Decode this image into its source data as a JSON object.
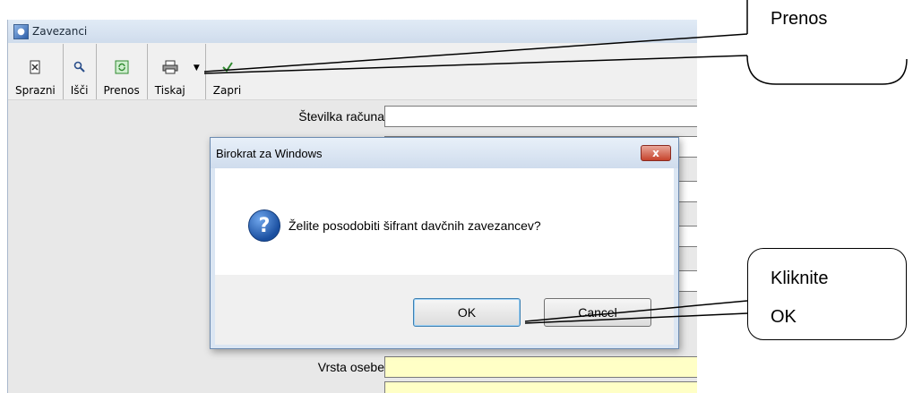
{
  "window": {
    "title": "Zavezanci",
    "icon": "app-icon"
  },
  "toolbar": {
    "buttons": [
      {
        "label": "Sprazni",
        "icon": "sprazni-icon"
      },
      {
        "label": "Išči",
        "icon": "search-icon"
      },
      {
        "label": "Prenos",
        "icon": "transfer-icon"
      },
      {
        "label": "Tiskaj",
        "icon": "printer-icon"
      },
      {
        "label": "Zapri",
        "icon": "close-check-icon"
      }
    ]
  },
  "form": {
    "fields": [
      {
        "label": "Številka računa",
        "value": ""
      },
      {
        "label": "Vrsta osebe",
        "value": ""
      }
    ]
  },
  "dialog": {
    "title": "Birokrat za Windows",
    "close_label": "x",
    "message": "Želite posodobiti šifrant davčnih zavezancev?",
    "icon": "question-icon",
    "ok_label": "OK",
    "cancel_label": "Cancel"
  },
  "callouts": {
    "prenos": "Prenos",
    "kliknite_line1": "Kliknite",
    "kliknite_line2": "OK"
  },
  "colors": {
    "dialog_frame": "#dbe6f3",
    "close_button": "#c6432c",
    "highlight_input": "#ffffc6"
  }
}
